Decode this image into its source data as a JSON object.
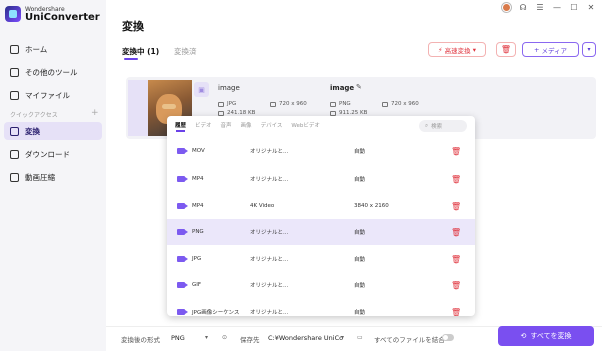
{
  "app": {
    "brand_top": "Wondershare",
    "brand_main": "UniConverter"
  },
  "sidebar": {
    "items": [
      {
        "label": "ホーム",
        "icon": "home-icon"
      },
      {
        "label": "その他のツール",
        "icon": "toolbox-icon"
      },
      {
        "label": "マイファイル",
        "icon": "folder-icon"
      }
    ],
    "quick_access_label": "クイックアクセス",
    "quick_items": [
      {
        "label": "変換",
        "icon": "convert-icon",
        "active": true
      },
      {
        "label": "ダウンロード",
        "icon": "download-icon"
      },
      {
        "label": "動画圧縮",
        "icon": "compress-icon"
      }
    ]
  },
  "header": {
    "title": "変換",
    "tabs": [
      {
        "label": "変換中 (1)"
      },
      {
        "label": "変換済"
      }
    ],
    "speed_button": "高速変換",
    "add_media_button": "メディア"
  },
  "file": {
    "input_name": "image",
    "input_format": "JPG",
    "input_resolution": "720 x 960",
    "input_size": "241.18 KB",
    "output_name": "image",
    "output_format": "PNG",
    "output_resolution": "720 x 960",
    "output_size": "911.25 KB"
  },
  "format_popup": {
    "tabs": [
      "履歴",
      "ビデオ",
      "音声",
      "画像",
      "デバイス",
      "Webビデオ"
    ],
    "search_placeholder": "検索",
    "rows": [
      {
        "format": "MOV",
        "quality": "オリジナルと...",
        "resolution": "自動"
      },
      {
        "format": "MP4",
        "quality": "オリジナルと...",
        "resolution": "自動"
      },
      {
        "format": "MP4",
        "quality": "4K Video",
        "resolution": "3840 x 2160"
      },
      {
        "format": "PNG",
        "quality": "オリジナルと...",
        "resolution": "自動",
        "selected": true
      },
      {
        "format": "JPG",
        "quality": "オリジナルと...",
        "resolution": "自動"
      },
      {
        "format": "GIF",
        "quality": "オリジナルと...",
        "resolution": "自動"
      },
      {
        "format": "JPG画像シーケンス",
        "quality": "オリジナルと...",
        "resolution": "自動"
      }
    ]
  },
  "bottom": {
    "format_label": "変換後の形式",
    "format_value": "PNG",
    "save_label": "保存先",
    "save_path": "C:¥Wondershare UniCo",
    "merge_label": "すべてのファイルを結合",
    "convert_all": "すべてを変換"
  },
  "colors": {
    "accent": "#7a4ff0",
    "danger": "#e0343e",
    "active_bg": "#e6e1f7"
  }
}
